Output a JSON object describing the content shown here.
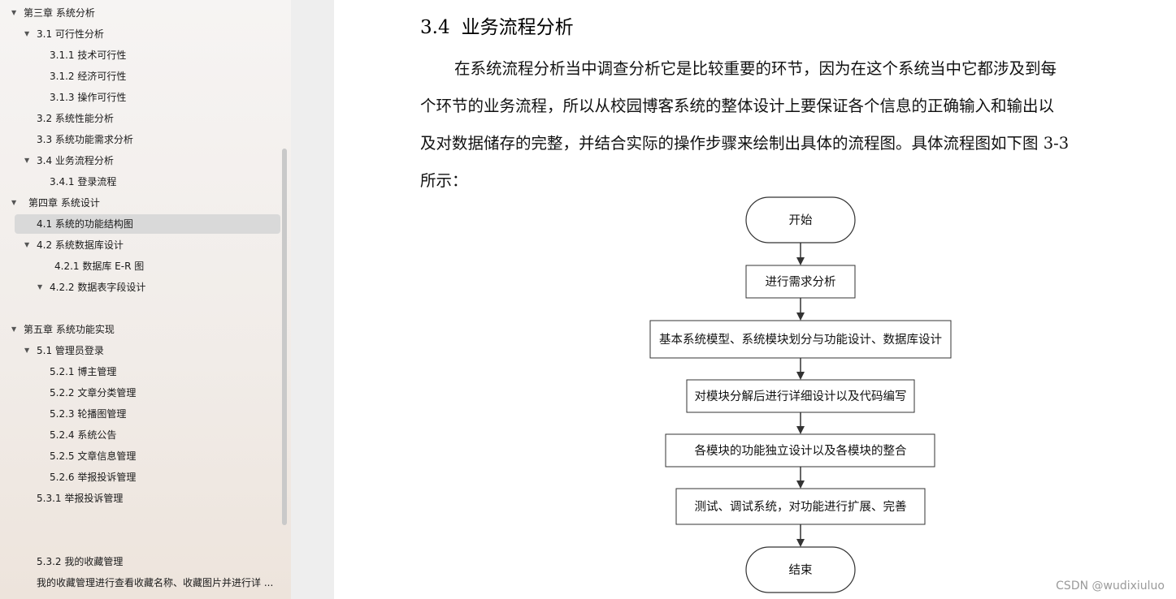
{
  "sidebar": {
    "items": [
      {
        "label": "第三章  系统分析",
        "arrow": true
      },
      {
        "label": "3.1  可行性分析",
        "arrow": true
      },
      {
        "label": "3.1.1    技术可行性",
        "arrow": false
      },
      {
        "label": "3.1.2  经济可行性",
        "arrow": false
      },
      {
        "label": "3.1.3  操作可行性",
        "arrow": false
      },
      {
        "label": "3.2  系统性能分析",
        "arrow": false
      },
      {
        "label": "3.3  系统功能需求分析",
        "arrow": false
      },
      {
        "label": "3.4  业务流程分析",
        "arrow": true
      },
      {
        "label": "3.4.1 登录流程",
        "arrow": false
      },
      {
        "label": "第四章  系统设计",
        "arrow": true
      },
      {
        "label": "4.1  系统的功能结构图",
        "arrow": false
      },
      {
        "label": "4.2  系统数据库设计",
        "arrow": true
      },
      {
        "label": "4.2.1    数据库 E-R 图",
        "arrow": false
      },
      {
        "label": "4.2.2    数据表字段设计",
        "arrow": true
      },
      {
        "label": "第五章  系统功能实现",
        "arrow": true
      },
      {
        "label": "5.1 管理员登录",
        "arrow": true
      },
      {
        "label": "5.2.1  博主管理",
        "arrow": false
      },
      {
        "label": "5.2.2  文章分类管理",
        "arrow": false
      },
      {
        "label": "5.2.3 轮播图管理",
        "arrow": false
      },
      {
        "label": "5.2.4  系统公告",
        "arrow": false
      },
      {
        "label": "5.2.5  文章信息管理",
        "arrow": false
      },
      {
        "label": "5.2.6  举报投诉管理",
        "arrow": false
      },
      {
        "label": "5.3.1 举报投诉管理",
        "arrow": false
      },
      {
        "label": "5.3.2 我的收藏管理",
        "arrow": false
      },
      {
        "label": "我的收藏管理进行查看收藏名称、收藏图片并进行详 ...",
        "arrow": false
      }
    ],
    "selected_label": "4.1  系统的功能结构图"
  },
  "doc": {
    "heading_num": "3.4",
    "heading_text": "业务流程分析",
    "para_lines": [
      "在系统流程分析当中调查分析它是比较重要的环节，因为在这个系统当中它都涉及到每",
      "个环节的业务流程，所以从校园博客系统的整体设计上要保证各个信息的正确输入和输出以",
      "及对数据储存的完整，并结合实际的操作步骤来绘制出具体的流程图。具体流程图如下图 3-3",
      "所示："
    ],
    "flow": {
      "start": "开始",
      "steps": [
        "进行需求分析",
        "基本系统模型、系统模块划分与功能设计、数据库设计",
        "对模块分解后进行详细设计以及代码编写",
        "各模块的功能独立设计以及各模块的整合",
        "测试、调试系统，对功能进行扩展、完善"
      ],
      "end": "结束"
    }
  },
  "watermark": "CSDN @wudixiuluo"
}
